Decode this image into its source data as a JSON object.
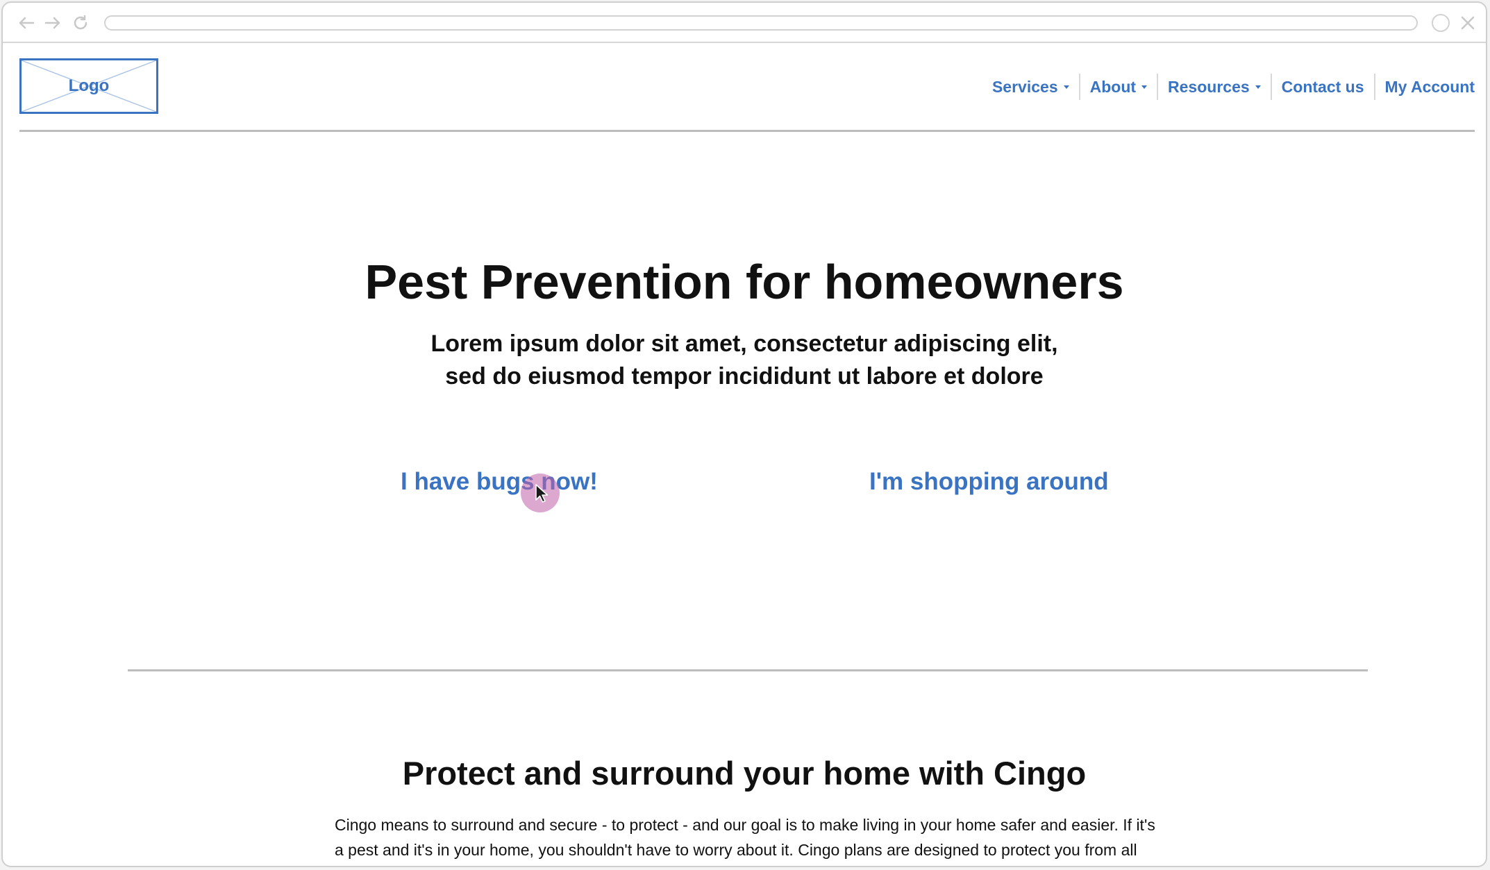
{
  "header": {
    "logo_label": "Logo",
    "nav": [
      {
        "label": "Services",
        "has_dropdown": true
      },
      {
        "label": "About",
        "has_dropdown": true
      },
      {
        "label": "Resources",
        "has_dropdown": true
      },
      {
        "label": "Contact us",
        "has_dropdown": false
      },
      {
        "label": "My Account",
        "has_dropdown": false
      }
    ]
  },
  "hero": {
    "title": "Pest Prevention for homeowners",
    "subtitle_line1": "Lorem ipsum dolor sit amet, consectetur adipiscing elit,",
    "subtitle_line2": "sed do eiusmod tempor incididunt ut labore et dolore",
    "cta_primary": "I have bugs now!",
    "cta_secondary": "I'm shopping around"
  },
  "section": {
    "title": "Protect and surround your home with Cingo",
    "body": "Cingo means to surround and secure - to protect - and our goal is to make living in your home safer and easier. If it's a pest and it's in your home, you shouldn't have to worry about it. Cingo plans are designed to protect you from all pests and treat your home from the outside of your home. We provide you with a professional for"
  },
  "colors": {
    "accent": "#3a73c1",
    "text": "#111111",
    "cursor_highlight": "#c060aa"
  },
  "icons": [
    "back-arrow-icon",
    "forward-arrow-icon",
    "reload-icon",
    "window-circle-icon",
    "close-icon",
    "caret-down-icon",
    "mouse-pointer-icon"
  ]
}
